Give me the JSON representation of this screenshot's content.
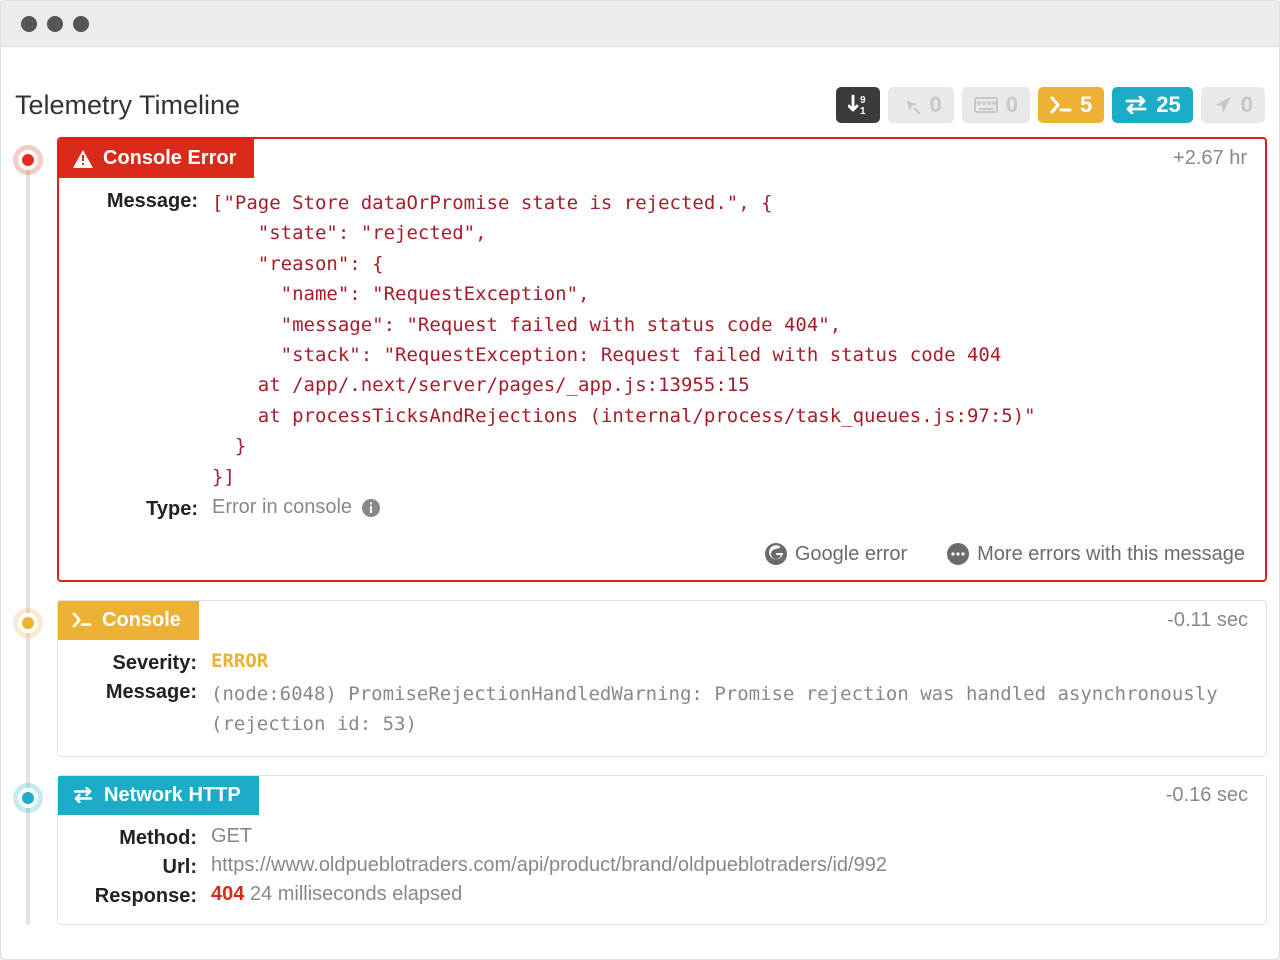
{
  "page_title": "Telemetry Timeline",
  "badges": {
    "sort": {
      "count": ""
    },
    "clicks": {
      "count": "0"
    },
    "inputs": {
      "count": "0"
    },
    "console": {
      "count": "5"
    },
    "network": {
      "count": "25"
    },
    "nav": {
      "count": "0"
    }
  },
  "items": [
    {
      "tag": "Console Error",
      "timestamp": "+2.67 hr",
      "labels": {
        "message": "Message:",
        "type": "Type:"
      },
      "message": "[\"Page Store dataOrPromise state is rejected.\", {\n    \"state\": \"rejected\",\n    \"reason\": {\n      \"name\": \"RequestException\",\n      \"message\": \"Request failed with status code 404\",\n      \"stack\": \"RequestException: Request failed with status code 404\n    at /app/.next/server/pages/_app.js:13955:15\n    at processTicksAndRejections (internal/process/task_queues.js:97:5)\"\n  }\n}]",
      "type_value": "Error in console",
      "actions": {
        "google": "Google error",
        "more": "More errors with this message"
      }
    },
    {
      "tag": "Console",
      "timestamp": "-0.11 sec",
      "labels": {
        "severity": "Severity:",
        "message": "Message:"
      },
      "severity": "ERROR",
      "message": "(node:6048) PromiseRejectionHandledWarning: Promise rejection was handled asynchronously (rejection id: 53)"
    },
    {
      "tag": "Network HTTP",
      "timestamp": "-0.16 sec",
      "labels": {
        "method": "Method:",
        "url": "Url:",
        "response": "Response:"
      },
      "method": "GET",
      "url": "https://www.oldpueblotraders.com/api/product/brand/oldpueblotraders/id/992",
      "response_code": "404",
      "response_rest": " 24 milliseconds elapsed"
    }
  ]
}
